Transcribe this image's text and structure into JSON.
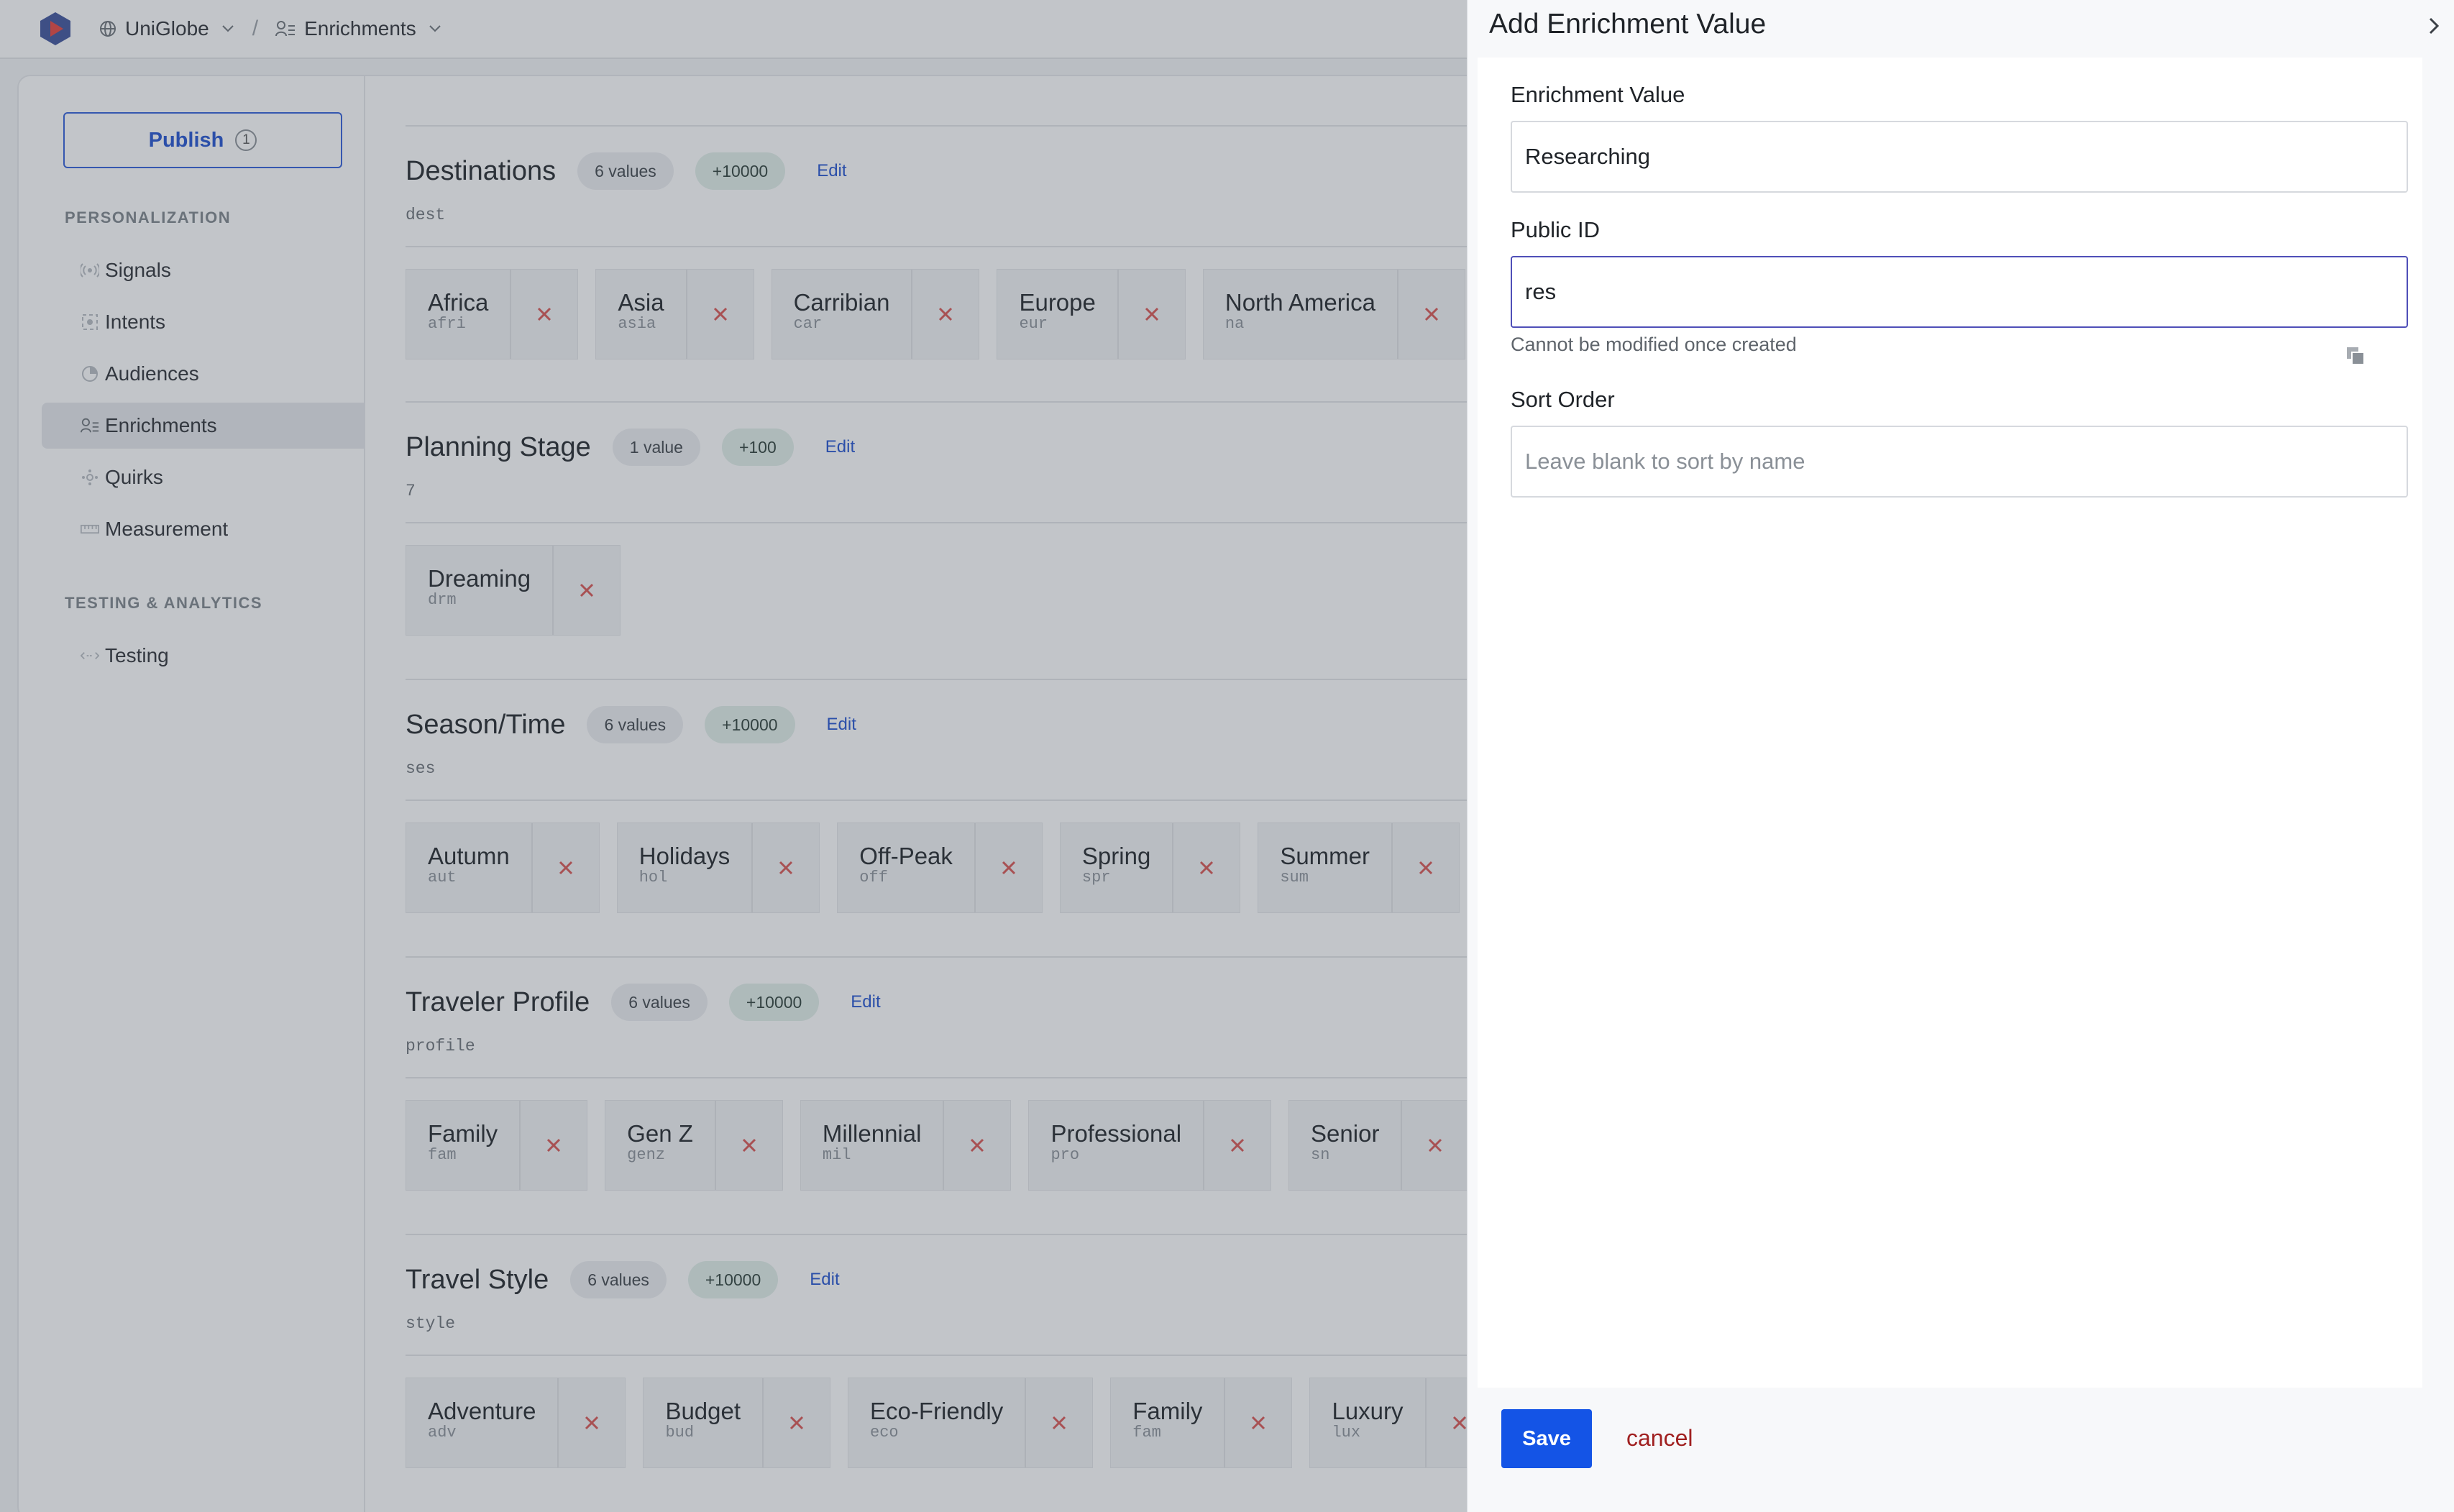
{
  "topbar": {
    "workspace": "UniGlobe",
    "section": "Enrichments",
    "separator": "/"
  },
  "sidebar": {
    "publish_label": "Publish",
    "publish_count": "1",
    "personalization_heading": "PERSONALIZATION",
    "items": [
      {
        "label": "Signals",
        "icon": "signal-icon"
      },
      {
        "label": "Intents",
        "icon": "intent-icon"
      },
      {
        "label": "Audiences",
        "icon": "audience-icon"
      },
      {
        "label": "Enrichments",
        "icon": "enrichment-icon",
        "active": true
      },
      {
        "label": "Quirks",
        "icon": "quirk-icon"
      },
      {
        "label": "Measurement",
        "icon": "ruler-icon"
      }
    ],
    "testing_heading": "TESTING & ANALYTICS",
    "testing_items": [
      {
        "label": "Testing",
        "icon": "testing-icon"
      }
    ]
  },
  "sections": [
    {
      "title": "Destinations",
      "values": "6 values",
      "score": "+10000",
      "edit": "Edit",
      "id": "dest",
      "chips": [
        {
          "name": "Africa",
          "code": "afri"
        },
        {
          "name": "Asia",
          "code": "asia"
        },
        {
          "name": "Carribian",
          "code": "car"
        },
        {
          "name": "Europe",
          "code": "eur"
        },
        {
          "name": "North America",
          "code": "na"
        }
      ]
    },
    {
      "title": "Planning Stage",
      "values": "1 value",
      "score": "+100",
      "edit": "Edit",
      "id": "7",
      "chips": [
        {
          "name": "Dreaming",
          "code": "drm"
        }
      ]
    },
    {
      "title": "Season/Time",
      "values": "6 values",
      "score": "+10000",
      "edit": "Edit",
      "id": "ses",
      "chips": [
        {
          "name": "Autumn",
          "code": "aut"
        },
        {
          "name": "Holidays",
          "code": "hol"
        },
        {
          "name": "Off-Peak",
          "code": "off"
        },
        {
          "name": "Spring",
          "code": "spr"
        },
        {
          "name": "Summer",
          "code": "sum"
        }
      ]
    },
    {
      "title": "Traveler Profile",
      "values": "6 values",
      "score": "+10000",
      "edit": "Edit",
      "id": "profile",
      "chips": [
        {
          "name": "Family",
          "code": "fam"
        },
        {
          "name": "Gen Z",
          "code": "genz"
        },
        {
          "name": "Millennial",
          "code": "mil"
        },
        {
          "name": "Professional",
          "code": "pro"
        },
        {
          "name": "Senior",
          "code": "sn"
        }
      ]
    },
    {
      "title": "Travel Style",
      "values": "6 values",
      "score": "+10000",
      "edit": "Edit",
      "id": "style",
      "chips": [
        {
          "name": "Adventure",
          "code": "adv"
        },
        {
          "name": "Budget",
          "code": "bud"
        },
        {
          "name": "Eco-Friendly",
          "code": "eco"
        },
        {
          "name": "Family",
          "code": "fam"
        },
        {
          "name": "Luxury",
          "code": "lux"
        }
      ]
    }
  ],
  "drawer": {
    "title": "Add Enrichment Value",
    "enrichment_value_label": "Enrichment Value",
    "enrichment_value": "Researching",
    "public_id_label": "Public ID",
    "public_id_value": "res",
    "public_id_help": "Cannot be modified once created",
    "sort_order_label": "Sort Order",
    "sort_order_placeholder": "Leave blank to sort by name",
    "save_label": "Save",
    "cancel_label": "cancel"
  },
  "colors": {
    "accent": "#1454e6",
    "link": "#1f4fcf",
    "danger": "#d9534f",
    "cancel": "#a02020",
    "overlay": "#464e5c"
  }
}
